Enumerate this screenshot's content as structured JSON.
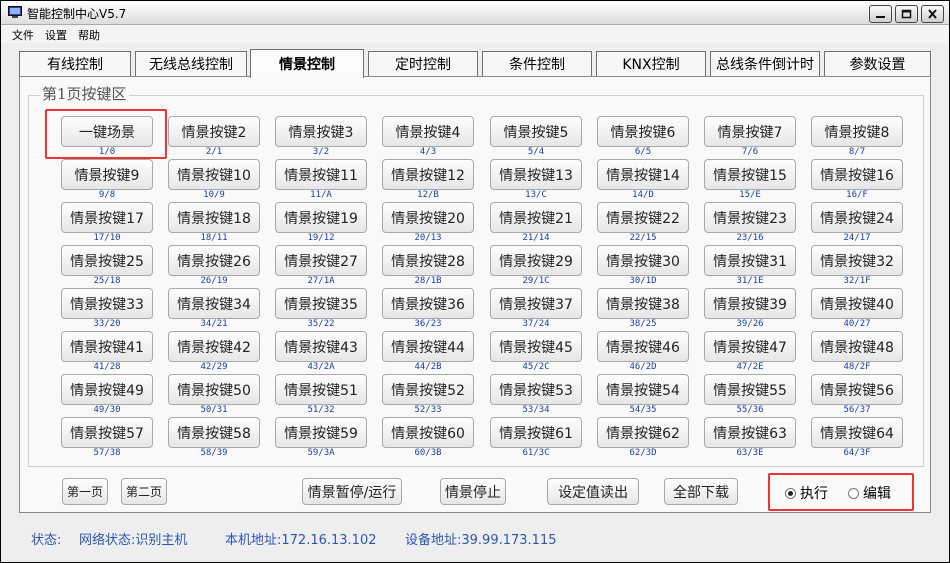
{
  "window": {
    "title": "智能控制中心V5.7",
    "controls": {
      "minimize": "minimize-icon",
      "maximize": "maximize-icon",
      "close": "close-icon"
    }
  },
  "menu": [
    "文件",
    "设置",
    "帮助"
  ],
  "tabs": [
    "有线控制",
    "无线总线控制",
    "情景控制",
    "定时控制",
    "条件控制",
    "KNX控制",
    "总线条件倒计时",
    "参数设置"
  ],
  "active_tab_index": 2,
  "page_title": "第1页按键区",
  "keys": [
    {
      "label": "一键场景",
      "code": "1/0"
    },
    {
      "label": "情景按键2",
      "code": "2/1"
    },
    {
      "label": "情景按键3",
      "code": "3/2"
    },
    {
      "label": "情景按键4",
      "code": "4/3"
    },
    {
      "label": "情景按键5",
      "code": "5/4"
    },
    {
      "label": "情景按键6",
      "code": "6/5"
    },
    {
      "label": "情景按键7",
      "code": "7/6"
    },
    {
      "label": "情景按键8",
      "code": "8/7"
    },
    {
      "label": "情景按键9",
      "code": "9/8"
    },
    {
      "label": "情景按键10",
      "code": "10/9"
    },
    {
      "label": "情景按键11",
      "code": "11/A"
    },
    {
      "label": "情景按键12",
      "code": "12/B"
    },
    {
      "label": "情景按键13",
      "code": "13/C"
    },
    {
      "label": "情景按键14",
      "code": "14/D"
    },
    {
      "label": "情景按键15",
      "code": "15/E"
    },
    {
      "label": "情景按键16",
      "code": "16/F"
    },
    {
      "label": "情景按键17",
      "code": "17/10"
    },
    {
      "label": "情景按键18",
      "code": "18/11"
    },
    {
      "label": "情景按键19",
      "code": "19/12"
    },
    {
      "label": "情景按键20",
      "code": "20/13"
    },
    {
      "label": "情景按键21",
      "code": "21/14"
    },
    {
      "label": "情景按键22",
      "code": "22/15"
    },
    {
      "label": "情景按键23",
      "code": "23/16"
    },
    {
      "label": "情景按键24",
      "code": "24/17"
    },
    {
      "label": "情景按键25",
      "code": "25/18"
    },
    {
      "label": "情景按键26",
      "code": "26/19"
    },
    {
      "label": "情景按键27",
      "code": "27/1A"
    },
    {
      "label": "情景按键28",
      "code": "28/1B"
    },
    {
      "label": "情景按键29",
      "code": "29/1C"
    },
    {
      "label": "情景按键30",
      "code": "30/1D"
    },
    {
      "label": "情景按键31",
      "code": "31/1E"
    },
    {
      "label": "情景按键32",
      "code": "32/1F"
    },
    {
      "label": "情景按键33",
      "code": "33/20"
    },
    {
      "label": "情景按键34",
      "code": "34/21"
    },
    {
      "label": "情景按键35",
      "code": "35/22"
    },
    {
      "label": "情景按键36",
      "code": "36/23"
    },
    {
      "label": "情景按键37",
      "code": "37/24"
    },
    {
      "label": "情景按键38",
      "code": "38/25"
    },
    {
      "label": "情景按键39",
      "code": "39/26"
    },
    {
      "label": "情景按键40",
      "code": "40/27"
    },
    {
      "label": "情景按键41",
      "code": "41/28"
    },
    {
      "label": "情景按键42",
      "code": "42/29"
    },
    {
      "label": "情景按键43",
      "code": "43/2A"
    },
    {
      "label": "情景按键44",
      "code": "44/2B"
    },
    {
      "label": "情景按键45",
      "code": "45/2C"
    },
    {
      "label": "情景按键46",
      "code": "46/2D"
    },
    {
      "label": "情景按键47",
      "code": "47/2E"
    },
    {
      "label": "情景按键48",
      "code": "48/2F"
    },
    {
      "label": "情景按键49",
      "code": "49/30"
    },
    {
      "label": "情景按键50",
      "code": "50/31"
    },
    {
      "label": "情景按键51",
      "code": "51/32"
    },
    {
      "label": "情景按键52",
      "code": "52/33"
    },
    {
      "label": "情景按键53",
      "code": "53/34"
    },
    {
      "label": "情景按键54",
      "code": "54/35"
    },
    {
      "label": "情景按键55",
      "code": "55/36"
    },
    {
      "label": "情景按键56",
      "code": "56/37"
    },
    {
      "label": "情景按键57",
      "code": "57/38"
    },
    {
      "label": "情景按键58",
      "code": "58/39"
    },
    {
      "label": "情景按键59",
      "code": "59/3A"
    },
    {
      "label": "情景按键60",
      "code": "60/3B"
    },
    {
      "label": "情景按键61",
      "code": "61/3C"
    },
    {
      "label": "情景按键62",
      "code": "62/3D"
    },
    {
      "label": "情景按键63",
      "code": "63/3E"
    },
    {
      "label": "情景按键64",
      "code": "64/3F"
    }
  ],
  "bottom": {
    "page1": "第一页",
    "page2": "第二页",
    "pause_run": "情景暂停/运行",
    "stop": "情景停止",
    "read_setting": "设定值读出",
    "download_all": "全部下载",
    "mode_execute": "执行",
    "mode_edit": "编辑",
    "mode_selected": "执行"
  },
  "status": {
    "label": "状态:",
    "network": "网络状态:识别主机",
    "local_address": "本机地址:172.16.13.102",
    "device_address": "设备地址:39.99.173.115"
  },
  "colors": {
    "highlight": "#e33333",
    "code_text": "#1e3fa0",
    "status_text": "#2d56b4"
  }
}
